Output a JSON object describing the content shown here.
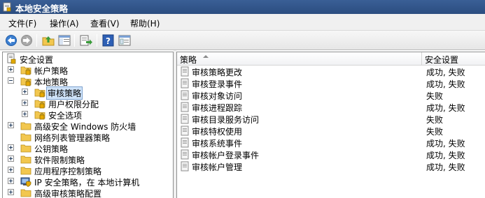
{
  "window": {
    "title": "本地安全策略"
  },
  "menu": [
    "文件(F)",
    "操作(A)",
    "查看(V)",
    "帮助(H)"
  ],
  "toolbar": [
    "back-icon",
    "forward-icon",
    "up-folder-icon",
    "show-hide-tree-icon",
    "export-list-icon",
    "help-icon",
    "properties-icon"
  ],
  "tree": [
    {
      "label": "安全设置",
      "level": 0,
      "expander": "none",
      "icon": "security-settings-icon"
    },
    {
      "label": "帐户策略",
      "level": 1,
      "expander": "plus",
      "icon": "folder-lock-icon"
    },
    {
      "label": "本地策略",
      "level": 1,
      "expander": "minus",
      "icon": "folder-lock-icon"
    },
    {
      "label": "审核策略",
      "level": 2,
      "expander": "plus",
      "icon": "folder-lock-icon",
      "selected": true
    },
    {
      "label": "用户权限分配",
      "level": 2,
      "expander": "plus",
      "icon": "folder-lock-icon"
    },
    {
      "label": "安全选项",
      "level": 2,
      "expander": "plus",
      "icon": "folder-lock-icon"
    },
    {
      "label": "高级安全 Windows 防火墙",
      "level": 1,
      "expander": "plus",
      "icon": "folder-icon"
    },
    {
      "label": "网络列表管理器策略",
      "level": 1,
      "expander": "none",
      "icon": "folder-icon"
    },
    {
      "label": "公钥策略",
      "level": 1,
      "expander": "plus",
      "icon": "folder-icon"
    },
    {
      "label": "软件限制策略",
      "level": 1,
      "expander": "plus",
      "icon": "folder-icon"
    },
    {
      "label": "应用程序控制策略",
      "level": 1,
      "expander": "plus",
      "icon": "folder-icon"
    },
    {
      "label": "IP 安全策略，在 本地计算机",
      "level": 1,
      "expander": "plus",
      "icon": "ip-security-icon"
    },
    {
      "label": "高级审核策略配置",
      "level": 1,
      "expander": "plus",
      "icon": "folder-icon"
    }
  ],
  "list": {
    "columns": [
      "策略",
      "安全设置"
    ],
    "rows": [
      {
        "name": "审核策略更改",
        "value": "成功, 失败"
      },
      {
        "name": "审核登录事件",
        "value": "成功, 失败"
      },
      {
        "name": "审核对象访问",
        "value": "失败"
      },
      {
        "name": "审核进程跟踪",
        "value": "成功, 失败"
      },
      {
        "name": "审核目录服务访问",
        "value": "失败"
      },
      {
        "name": "审核特权使用",
        "value": "失败"
      },
      {
        "name": "审核系统事件",
        "value": "成功, 失败"
      },
      {
        "name": "审核帐户登录事件",
        "value": "成功, 失败"
      },
      {
        "name": "审核帐户管理",
        "value": "成功, 失败"
      }
    ]
  }
}
